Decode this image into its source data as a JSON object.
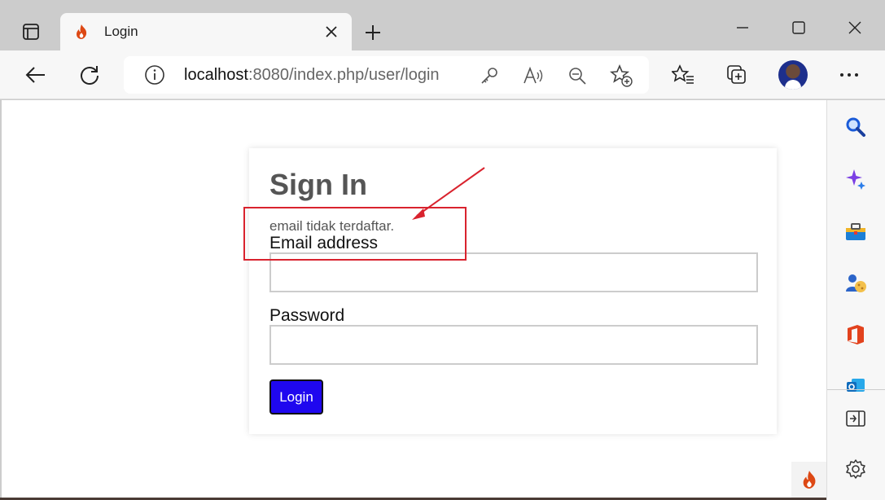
{
  "browser": {
    "tab": {
      "title": "Login",
      "favicon": "codeigniter-flame-icon"
    },
    "address": {
      "host": "localhost",
      "rest": ":8080/index.php/user/login"
    },
    "toolbar_icons": [
      "back-icon",
      "refresh-icon",
      "info-icon",
      "key-icon",
      "read-aloud-icon",
      "zoom-out-icon",
      "add-favorite-icon",
      "favorites-icon",
      "collections-icon",
      "more-icon"
    ],
    "sidebar_icons": [
      "search-icon",
      "copilot-icon",
      "tools-icon",
      "games-icon",
      "office-icon",
      "outlook-icon",
      "split-screen-icon",
      "settings-icon"
    ]
  },
  "page": {
    "heading": "Sign In",
    "error_message": "email tidak terdaftar.",
    "email_label": "Email address",
    "email_value": "",
    "password_label": "Password",
    "password_value": "",
    "login_button": "Login"
  },
  "colors": {
    "login_button": "#1f07ef",
    "annotation": "#d9232e",
    "heading": "#555555"
  }
}
